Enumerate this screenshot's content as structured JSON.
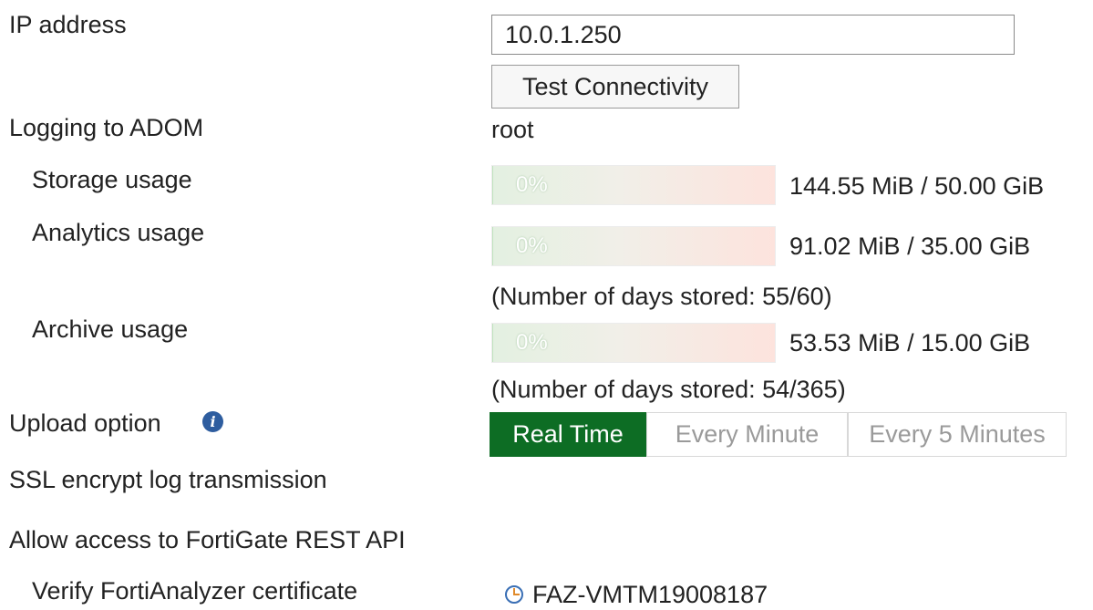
{
  "ip_address": {
    "label": "IP address",
    "value": "10.0.1.250",
    "test_button_label": "Test Connectivity"
  },
  "adom": {
    "label": "Logging to ADOM",
    "value": "root"
  },
  "usage": {
    "storage": {
      "label": "Storage usage",
      "percent_text": "0%",
      "fraction": 0.003,
      "amount": "144.55 MiB / 50.00 GiB"
    },
    "analytics": {
      "label": "Analytics usage",
      "percent_text": "0%",
      "fraction": 0.003,
      "amount": "91.02 MiB / 35.00 GiB",
      "days_note": "(Number of days stored: 55/60)"
    },
    "archive": {
      "label": "Archive usage",
      "percent_text": "0%",
      "fraction": 0.003,
      "amount": "53.53 MiB / 15.00 GiB",
      "days_note": "(Number of days stored: 54/365)"
    }
  },
  "upload_option": {
    "label": "Upload option",
    "info_icon": "info-icon",
    "options": [
      "Real Time",
      "Every Minute",
      "Every 5 Minutes"
    ],
    "selected": "Real Time",
    "active_color": "#0d6d24"
  },
  "ssl": {
    "label": "SSL encrypt log transmission"
  },
  "rest_api": {
    "label": "Allow access to FortiGate REST API"
  },
  "verify_cert": {
    "label": "Verify FortiAnalyzer certificate",
    "icon": "clock-icon",
    "value": "FAZ-VMTM19008187"
  }
}
